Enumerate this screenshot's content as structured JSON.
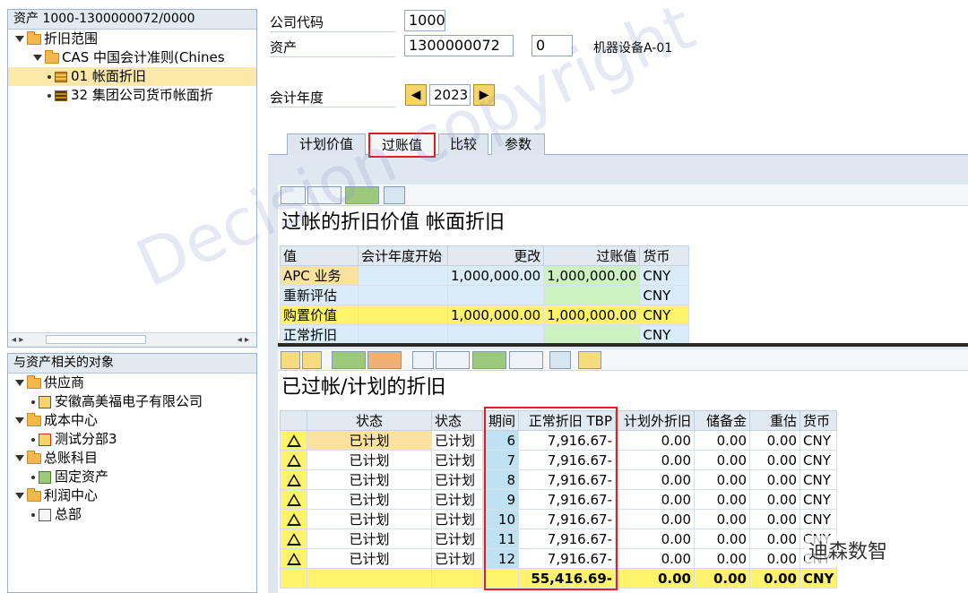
{
  "tree_top": {
    "title": "资产 1000-1300000072/0000",
    "items": [
      {
        "label": "折旧范围"
      },
      {
        "label": "CAS 中国会计准则(Chines"
      },
      {
        "label": "01 帐面折旧"
      },
      {
        "label": "32 集团公司货币帐面折"
      }
    ]
  },
  "tree_bottom": {
    "title": "与资产相关的对象",
    "items": [
      {
        "label": "供应商"
      },
      {
        "label": "安徽高美福电子有限公司"
      },
      {
        "label": "成本中心"
      },
      {
        "label": "测试分部3"
      },
      {
        "label": "总账科目"
      },
      {
        "label": "固定资产"
      },
      {
        "label": "利润中心"
      },
      {
        "label": "总部"
      }
    ]
  },
  "header": {
    "company_code_label": "公司代码",
    "company_code": "1000",
    "asset_label": "资产",
    "asset_number": "1300000072",
    "asset_sub": "0",
    "asset_desc": "机器设备A-01",
    "fiscal_year_label": "会计年度",
    "fiscal_year": "2023",
    "prev_glyph": "◀",
    "next_glyph": "▶"
  },
  "tabs": [
    {
      "label": "计划价值"
    },
    {
      "label": "过账值"
    },
    {
      "label": "比较"
    },
    {
      "label": "参数"
    }
  ],
  "values_grid": {
    "title": "过帐的折旧价值 帐面折旧",
    "columns": [
      "值",
      "会计年度开始",
      "更改",
      "过账值",
      "货币"
    ],
    "rows": [
      {
        "label": "APC 业务",
        "start": "",
        "change": "1,000,000.00",
        "posted": "1,000,000.00",
        "currency": "CNY"
      },
      {
        "label": "重新评估",
        "start": "",
        "change": "",
        "posted": "",
        "currency": "CNY"
      },
      {
        "label": "购置价值",
        "start": "",
        "change": "1,000,000.00",
        "posted": "1,000,000.00",
        "currency": "CNY"
      },
      {
        "label": "正常折旧",
        "start": "",
        "change": "",
        "posted": "",
        "currency": "CNY"
      }
    ]
  },
  "depr_grid": {
    "title": "已过帐/计划的折旧",
    "columns": [
      "状态",
      "状态",
      "期间",
      "正常折旧 TBP",
      "计划外折旧",
      "储备金",
      "重估",
      "货币"
    ],
    "rows": [
      {
        "status": "已计划",
        "status2": "已计划",
        "period": "6",
        "normal": "7,916.67-",
        "unplanned": "0.00",
        "reserve": "0.00",
        "reval": "0.00",
        "currency": "CNY"
      },
      {
        "status": "已计划",
        "status2": "已计划",
        "period": "7",
        "normal": "7,916.67-",
        "unplanned": "0.00",
        "reserve": "0.00",
        "reval": "0.00",
        "currency": "CNY"
      },
      {
        "status": "已计划",
        "status2": "已计划",
        "period": "8",
        "normal": "7,916.67-",
        "unplanned": "0.00",
        "reserve": "0.00",
        "reval": "0.00",
        "currency": "CNY"
      },
      {
        "status": "已计划",
        "status2": "已计划",
        "period": "9",
        "normal": "7,916.67-",
        "unplanned": "0.00",
        "reserve": "0.00",
        "reval": "0.00",
        "currency": "CNY"
      },
      {
        "status": "已计划",
        "status2": "已计划",
        "period": "10",
        "normal": "7,916.67-",
        "unplanned": "0.00",
        "reserve": "0.00",
        "reval": "0.00",
        "currency": "CNY"
      },
      {
        "status": "已计划",
        "status2": "已计划",
        "period": "11",
        "normal": "7,916.67-",
        "unplanned": "0.00",
        "reserve": "0.00",
        "reval": "0.00",
        "currency": "CNY"
      },
      {
        "status": "已计划",
        "status2": "已计划",
        "period": "12",
        "normal": "7,916.67-",
        "unplanned": "0.00",
        "reserve": "0.00",
        "reval": "0.00",
        "currency": "CNY"
      }
    ],
    "total": {
      "normal": "55,416.69-",
      "unplanned": "0.00",
      "reserve": "0.00",
      "reval": "0.00",
      "currency": "CNY"
    }
  },
  "overlay": {
    "watermark": "Decision copyright",
    "brand": "迪森数智"
  },
  "colors": {
    "highlight_red": "#e01e1e",
    "total_yellow": "#fff36b",
    "tree_selected": "#fce8a8"
  }
}
